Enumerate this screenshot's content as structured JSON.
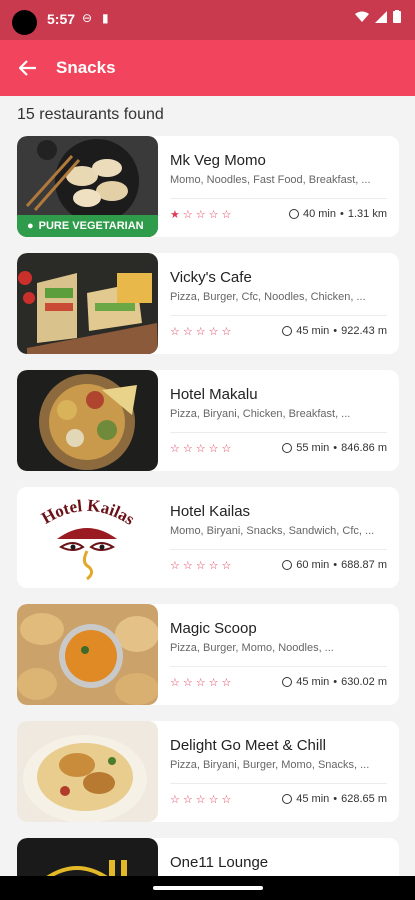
{
  "status_bar": {
    "time": "5:57"
  },
  "header": {
    "title": "Snacks"
  },
  "results_count": "15 restaurants found",
  "restaurants": [
    {
      "name": "Mk Veg Momo",
      "cuisines": "Momo, Noodles, Fast Food, Breakfast, ...",
      "rating": 1,
      "time": "40 min",
      "distance": "1.31 km",
      "badge": "PURE VEGETARIAN"
    },
    {
      "name": "Vicky's Cafe",
      "cuisines": "Pizza, Burger, Cfc, Noodles, Chicken, ...",
      "rating": 0,
      "time": "45 min",
      "distance": "922.43 m"
    },
    {
      "name": "Hotel Makalu",
      "cuisines": "Pizza, Biryani, Chicken, Breakfast, ...",
      "rating": 0,
      "time": "55 min",
      "distance": "846.86 m"
    },
    {
      "name": "Hotel Kailas",
      "cuisines": "Momo, Biryani, Snacks, Sandwich, Cfc, ...",
      "rating": 0,
      "time": "60 min",
      "distance": "688.87 m",
      "logo_text": "Hotel Kailas"
    },
    {
      "name": "Magic Scoop",
      "cuisines": "Pizza, Burger, Momo, Noodles, ...",
      "rating": 0,
      "time": "45 min",
      "distance": "630.02 m"
    },
    {
      "name": "Delight Go Meet & Chill",
      "cuisines": "Pizza, Biryani, Burger, Momo, Snacks, ...",
      "rating": 0,
      "time": "45 min",
      "distance": "628.65 m"
    },
    {
      "name": "One11 Lounge",
      "cuisines": "",
      "rating": 0,
      "time": "",
      "distance": ""
    }
  ],
  "colors": {
    "app_bar": "#f2445c",
    "status_bar": "#c93a4f",
    "star": "#e03a57",
    "veg": "#2e9c4a"
  }
}
